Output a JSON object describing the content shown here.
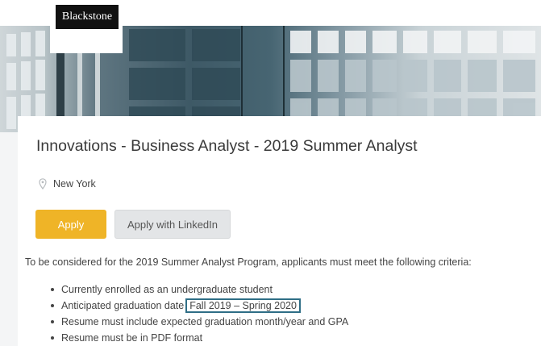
{
  "brand": {
    "logo_text": "Blackstone"
  },
  "job": {
    "title": "Innovations - Business Analyst - 2019 Summer Analyst",
    "location": "New York",
    "location_icon": "map-pin-icon"
  },
  "actions": {
    "apply_label": "Apply",
    "apply_color": "#efb427",
    "linkedin_label": "Apply with LinkedIn"
  },
  "description": {
    "intro": "To be considered for the 2019 Summer Analyst Program, applicants must meet the following criteria:",
    "criteria": [
      "Currently enrolled as an undergraduate student",
      "Anticipated graduation date",
      "Resume must include expected graduation month/year and GPA",
      "Resume must be in PDF format"
    ],
    "graduation_range": "Fall 2019 – Spring 2020",
    "highlight_color": "#2f6e86"
  }
}
